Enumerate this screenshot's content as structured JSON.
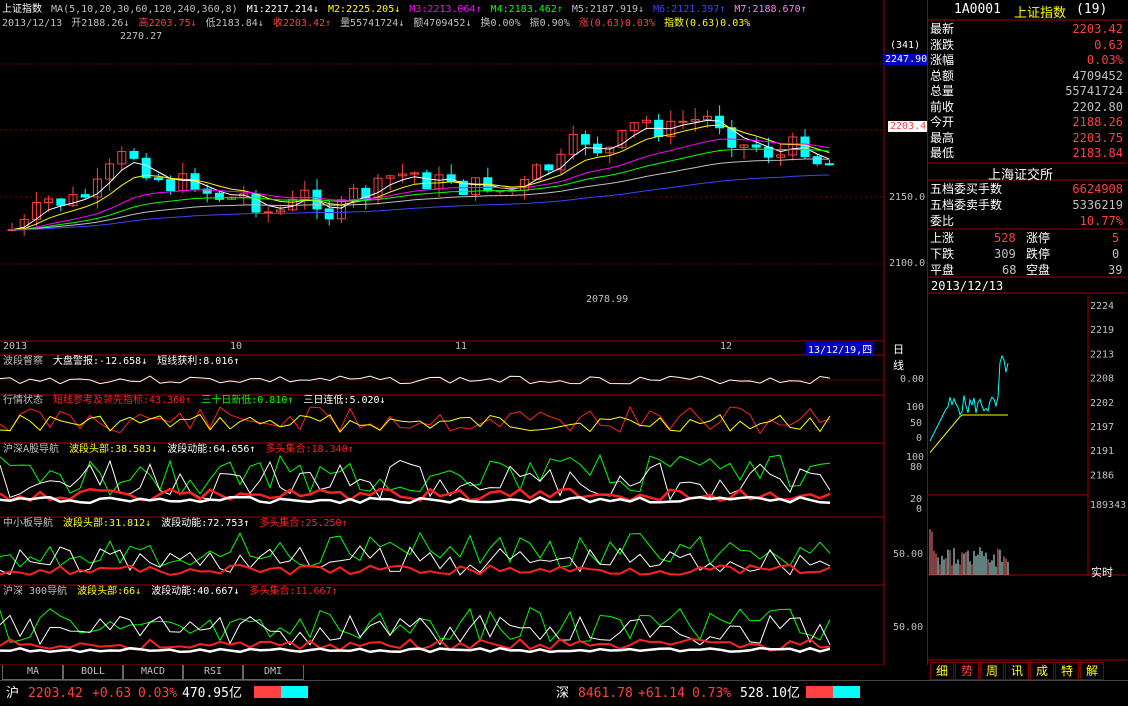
{
  "header": {
    "title": "上证指数",
    "ma_label": "MA(5,10,20,30,60,120,240,360,8)",
    "ma_values": [
      {
        "label": "M1:2217.214↓",
        "color": "#ffffff"
      },
      {
        "label": "M2:2225.205↓",
        "color": "#ffff00"
      },
      {
        "label": "M3:2213.064↑",
        "color": "#ff00ff"
      },
      {
        "label": "M4:2183.462↑",
        "color": "#00ff00"
      },
      {
        "label": "M5:2187.919↓",
        "color": "#c0c0c0"
      },
      {
        "label": "M6:2121.397↑",
        "color": "#4040ff"
      },
      {
        "label": "M7:2188.670↑",
        "color": "#ff80ff"
      }
    ],
    "date": "2013/12/13",
    "ohlc": [
      {
        "label": "开2188.26↓",
        "color": "#c0c0c0"
      },
      {
        "label": "高2203.75↓",
        "color": "#ff4040"
      },
      {
        "label": "低2183.84↓",
        "color": "#c0c0c0"
      },
      {
        "label": "收2203.42↑",
        "color": "#ff4040"
      },
      {
        "label": "量55741724↓",
        "color": "#c0c0c0"
      },
      {
        "label": "额4709452↓",
        "color": "#c0c0c0"
      },
      {
        "label": "换0.00%",
        "color": "#c0c0c0"
      },
      {
        "label": "振0.90%",
        "color": "#c0c0c0"
      },
      {
        "label": "涨(0.63)0.03%",
        "color": "#ff4040"
      },
      {
        "label": "指数(0.63)0.03%",
        "color": "#ffff00"
      }
    ]
  },
  "price_axis": {
    "labels": [
      "2247.90",
      "2150.0",
      "2100.0"
    ],
    "current_price_label": "2203.4",
    "count_label": "(341)"
  },
  "annotations": {
    "high": "2270.27",
    "low": "2078.99"
  },
  "month_labels": [
    "2013",
    "10",
    "11",
    "12"
  ],
  "date_box": "13/12/19,四",
  "period_label": "日线",
  "indicators": [
    {
      "name": "波段督察",
      "parts": [
        {
          "text": "大盘警报:-12.658↓",
          "color": "#ffffff"
        },
        {
          "text": "短线获利:8.016↑",
          "color": "#ffffff"
        }
      ],
      "axis": [
        "0.00"
      ]
    },
    {
      "name": "行情状态",
      "parts": [
        {
          "text": "短线参考及领先指标:43.360↑",
          "color": "#ff2020"
        },
        {
          "text": "三十日新低:0.810↑",
          "color": "#00ff00"
        },
        {
          "text": "三日连低:5.020↓",
          "color": "#ffffff"
        }
      ],
      "axis": [
        "100",
        "50",
        "0"
      ]
    },
    {
      "name": "沪深A股导航",
      "parts": [
        {
          "text": "波段头部:38.583↓",
          "color": "#ffff00"
        },
        {
          "text": "波段动能:64.656↑",
          "color": "#ffffff"
        },
        {
          "text": "多头集合:18.340↑",
          "color": "#ff2020"
        }
      ],
      "axis": [
        "100",
        "80",
        "20",
        "0"
      ]
    },
    {
      "name": "中小板导航",
      "parts": [
        {
          "text": "波段头部:31.812↓",
          "color": "#ffff00"
        },
        {
          "text": "波段动能:72.753↑",
          "color": "#ffffff"
        },
        {
          "text": "多头集合:25.250↑",
          "color": "#ff2020"
        }
      ],
      "axis": [
        "50.00"
      ]
    },
    {
      "name": "沪深 300导航",
      "parts": [
        {
          "text": "波段头部:66↓",
          "color": "#ffff00"
        },
        {
          "text": "波段动能:40.667↓",
          "color": "#ffffff"
        },
        {
          "text": "多头集合:11.667↑",
          "color": "#ff2020"
        }
      ],
      "axis": [
        "50.00"
      ]
    }
  ],
  "tabs": [
    "MA",
    "BOLL",
    "MACD",
    "RSI",
    "DMI"
  ],
  "right_panel": {
    "code_title": "1A0001",
    "name_title": "上证指数",
    "count": "(19)",
    "quote": [
      {
        "label": "最新",
        "value": "2203.42",
        "color": "#ff4040"
      },
      {
        "label": "涨跌",
        "value": "0.63",
        "color": "#ff4040"
      },
      {
        "label": "涨幅",
        "value": "0.03%",
        "color": "#ff4040"
      },
      {
        "label": "总额",
        "value": "4709452",
        "color": "#c0c0c0"
      },
      {
        "label": "总量",
        "value": "55741724",
        "color": "#c0c0c0"
      },
      {
        "label": "前收",
        "value": "2202.80",
        "color": "#c0c0c0"
      },
      {
        "label": "今开",
        "value": "2188.26",
        "color": "#ff4040"
      },
      {
        "label": "最高",
        "value": "2203.75",
        "color": "#ff4040"
      },
      {
        "label": "最低",
        "value": "2183.84",
        "color": "#ff4040"
      }
    ],
    "exchange": "上海证交所",
    "depth": [
      {
        "label": "五档委买手数",
        "value": "6624908",
        "color": "#ff4040"
      },
      {
        "label": "五档委卖手数",
        "value": "5336219",
        "color": "#c0c0c0"
      },
      {
        "label": "委比",
        "value": "10.77%",
        "color": "#ff4040"
      }
    ],
    "breadth": [
      {
        "l1": "上涨",
        "v1": "528",
        "c1": "#ff4040",
        "l2": "涨停",
        "v2": "5",
        "c2": "#ff4040"
      },
      {
        "l1": "下跌",
        "v1": "309",
        "c1": "#c0c0c0",
        "l2": "跌停",
        "v2": "0",
        "c2": "#c0c0c0"
      },
      {
        "l1": "平盘",
        "v1": "68",
        "c1": "#c0c0c0",
        "l2": "空盘",
        "v2": "39",
        "c2": "#c0c0c0"
      }
    ],
    "mini_date": "2013/12/13",
    "mini_axis": [
      "2224",
      "2219",
      "2213",
      "2208",
      "2202",
      "2197",
      "2191",
      "2186"
    ],
    "vol_label": "189343",
    "realtime": "实时",
    "bottom_tabs": [
      "细",
      "势",
      "周",
      "讯",
      "成",
      "特",
      "解"
    ]
  },
  "status_bar": {
    "sh_label": "沪",
    "sh_price": "2203.42",
    "sh_change": "+0.63",
    "sh_pct": "0.03%",
    "sh_amount": "470.95亿",
    "sz_label": "深",
    "sz_price": "8461.78",
    "sz_change": "+61.14",
    "sz_pct": "0.73%",
    "sz_amount": "528.10亿"
  },
  "colors": {
    "up": "#ff4040",
    "down": "#00ffff",
    "border": "#a00000",
    "ma1": "#ffffff",
    "ma2": "#ffff00",
    "ma3": "#ff00ff",
    "ma4": "#00ff00",
    "ma6": "#4040ff"
  }
}
